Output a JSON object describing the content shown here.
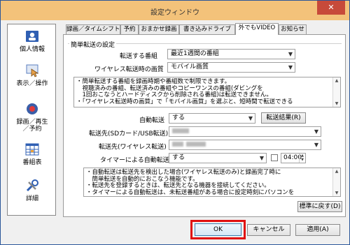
{
  "window": {
    "title": "設定ウィンドウ",
    "close_symbol": "✕"
  },
  "sidebar": {
    "items": [
      {
        "label": "個人情報",
        "icon": "id-card-icon"
      },
      {
        "label": "表示／操作",
        "icon": "hand-pointer-icon"
      },
      {
        "label": "録画／再生／予約",
        "icon": "record-icon"
      },
      {
        "label": "番組表",
        "icon": "grid-icon"
      },
      {
        "label": "詳細",
        "icon": "tools-icon"
      }
    ]
  },
  "tabs": [
    "録画／タイムシフト",
    "予約",
    "おまかせ録画",
    "書き込みドライブ",
    "外でもVIDEO",
    "お知らせ"
  ],
  "active_tab": "外でもVIDEO",
  "easy_transfer": {
    "legend": "簡単転送の設定",
    "program_label": "転送する番組",
    "program_value": "最近1週間の番組",
    "quality_label": "ワイヤレス転送時の画質",
    "quality_value": "モバイル画質",
    "note_lines": [
      "・簡単転送する番組を録画時期や番組数で制限できます。",
      "　視聴済みの番組、転送済みの番組やコピーワンスの番組(ダビングを",
      "　1回おこなうとハードディスクから削除される番組)は転送できません。",
      "・「ワイヤレス転送時の画質」で「モバイル画質」を選ぶと、短時間で転送できる"
    ]
  },
  "auto_transfer": {
    "label": "自動転送",
    "value": "する",
    "result_button": "転送結果(R)",
    "dest_sd_label": "転送先(SDカード/USB転送)",
    "dest_wireless_label": "転送先(ワイヤレス転送)",
    "timer_label": "タイマーによる自動転送",
    "timer_value": "する",
    "timer_time": "04:00",
    "note_lines": [
      "・自動転送は転送先を検出した場合(ワイヤレス転送のみ)と録画完了時に",
      "　簡単転送を自動的におこなう機能です。",
      "・転送先を登録するときは、転送先となる機器を接続してください。",
      "・タイマーによる自動転送は、未転送番組がある場合に設定時刻にパソコンを"
    ]
  },
  "buttons": {
    "restore_defaults": "標準に戻す(D)",
    "ok": "OK",
    "cancel": "キャンセル",
    "apply": "適用(A)"
  },
  "colors": {
    "titlebar": "#f3c27a",
    "close": "#c74a3a",
    "highlight": "#e01010"
  }
}
